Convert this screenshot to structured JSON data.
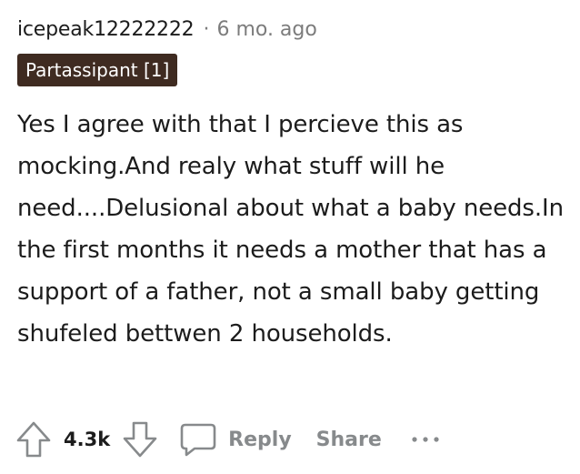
{
  "comment": {
    "username": "icepeak12222222",
    "separator": "·",
    "timestamp": "6 mo. ago",
    "flair": "Partassipant [1]",
    "body": "Yes I agree with that I percieve this as mocking.And realy what stuff will he need....Delusional about what a baby needs.In the first months it needs a mother that has a support of a father, not a small baby getting shufeled bettwen 2 households."
  },
  "actions": {
    "upvote_icon": "upvote-arrow-icon",
    "score": "4.3k",
    "downvote_icon": "downvote-arrow-icon",
    "reply_icon": "speech-bubble-icon",
    "reply_label": "Reply",
    "share_label": "Share",
    "more_icon": "more-options-icon"
  },
  "colors": {
    "text": "#1c1c1c",
    "muted": "#7c7c7c",
    "action_gray": "#878a8c",
    "flair_bg": "#3f2b21",
    "flair_text": "#ffffff"
  }
}
